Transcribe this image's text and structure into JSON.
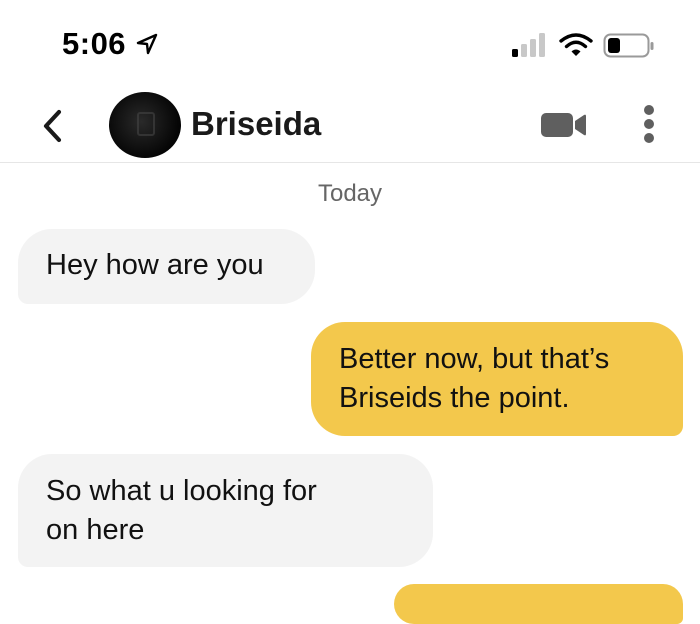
{
  "status_bar": {
    "time": "5:06",
    "location_icon": "location-arrow-icon",
    "signal_icon": "cellular-signal-icon",
    "wifi_icon": "wifi-icon",
    "battery_icon": "battery-low-icon"
  },
  "header": {
    "back_icon": "chevron-left-icon",
    "contact_name": "Briseida",
    "video_icon": "video-camera-icon",
    "more_icon": "more-vertical-icon"
  },
  "chat": {
    "date_divider": "Today",
    "messages": [
      {
        "direction": "incoming",
        "lines": [
          "Hey how are you"
        ]
      },
      {
        "direction": "outgoing",
        "lines": [
          "Better now, but that’s",
          "Briseids the point."
        ]
      },
      {
        "direction": "incoming",
        "lines": [
          "So what u looking for",
          "on here"
        ]
      },
      {
        "direction": "outgoing",
        "lines": []
      }
    ]
  },
  "colors": {
    "outgoing_bubble": "#f3c84c",
    "incoming_bubble": "#f3f3f3",
    "icon_gray": "#5f5f5f"
  }
}
